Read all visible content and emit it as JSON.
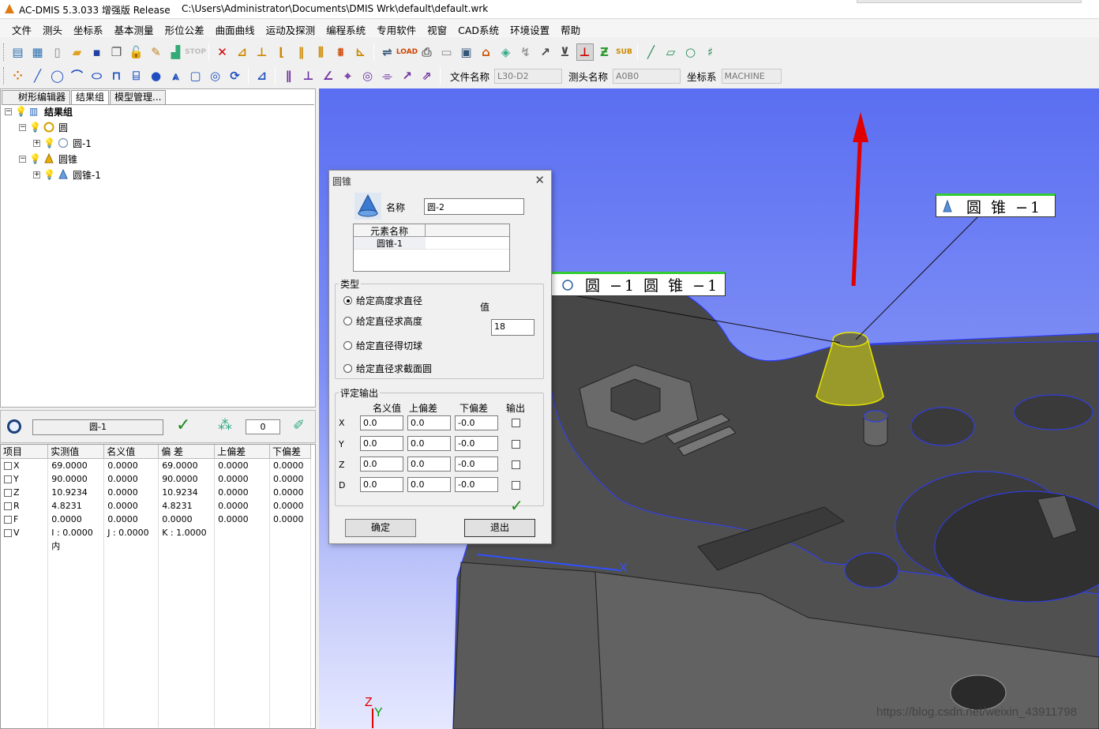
{
  "window": {
    "app_title": "AC-DMIS 5.3.033 增强版 Release",
    "file_path": "C:\\Users\\Administrator\\Documents\\DMIS Wrk\\default\\default.wrk"
  },
  "menu": [
    "文件",
    "测头",
    "坐标系",
    "基本测量",
    "形位公差",
    "曲面曲线",
    "运动及探测",
    "编程系统",
    "专用软件",
    "视窗",
    "CAD系统",
    "环境设置",
    "帮助"
  ],
  "toolbar2": {
    "file_label": "文件名称",
    "file_value": "L30-D2",
    "probe_label": "测头名称",
    "probe_value": "A0B0",
    "coord_label": "坐标系",
    "coord_value": "MACHINE"
  },
  "tabs": [
    "树形编辑器",
    "结果组",
    "模型管理..."
  ],
  "tree": {
    "root": "结果组",
    "circle_group": "圆",
    "circle_item": "圆-1",
    "cone_group": "圆锥",
    "cone_item": "圆锥-1"
  },
  "result_bar": {
    "feature_name": "圆-1",
    "count": "0"
  },
  "result_table": {
    "headers": [
      "项目",
      "实测值",
      "名义值",
      "偏 差",
      "上偏差",
      "下偏差"
    ],
    "rows": [
      [
        "X",
        "69.0000",
        "0.0000",
        "69.0000",
        "0.0000",
        "0.0000"
      ],
      [
        "Y",
        "90.0000",
        "0.0000",
        "90.0000",
        "0.0000",
        "0.0000"
      ],
      [
        "Z",
        "10.9234",
        "0.0000",
        "10.9234",
        "0.0000",
        "0.0000"
      ],
      [
        "R",
        "4.8231",
        "0.0000",
        "4.8231",
        "0.0000",
        "0.0000"
      ],
      [
        "F",
        "0.0000",
        "0.0000",
        "0.0000",
        "0.0000",
        "0.0000"
      ]
    ],
    "v_row": {
      "label": "V",
      "i": "I : 0.0000",
      "j": "J : 0.0000",
      "k": "K : 1.0000"
    },
    "extra": "内"
  },
  "dialog": {
    "title": "圆锥",
    "name_label": "名称",
    "name_value": "圆-2",
    "element_col": "元素名称",
    "element_item": "圆锥-1",
    "type_group": "类型",
    "options": [
      "给定高度求直径",
      "给定直径求高度",
      "给定直径得切球",
      "给定直径求截面圆"
    ],
    "value_label": "值",
    "value": "18",
    "eval_group": "评定输出",
    "eval_headers": [
      "名义值",
      "上偏差",
      "下偏差",
      "输出"
    ],
    "eval_rows": [
      {
        "axis": "X",
        "nominal": "0.0",
        "upper": "0.0",
        "lower": "-0.0"
      },
      {
        "axis": "Y",
        "nominal": "0.0",
        "upper": "0.0",
        "lower": "-0.0"
      },
      {
        "axis": "Z",
        "nominal": "0.0",
        "upper": "0.0",
        "lower": "-0.0"
      },
      {
        "axis": "D",
        "nominal": "0.0",
        "upper": "0.0",
        "lower": "-0.0"
      }
    ],
    "ok_label": "确定",
    "exit_label": "退出"
  },
  "viewport": {
    "callout_cone": "圆 锥 −1",
    "callout_pair": "圆 −1  圆 锥 −1",
    "axis_x": "X",
    "axis_y": "Y",
    "axis_z": "Z"
  },
  "watermark": "https://blog.csdn.net/weixin_43911798"
}
